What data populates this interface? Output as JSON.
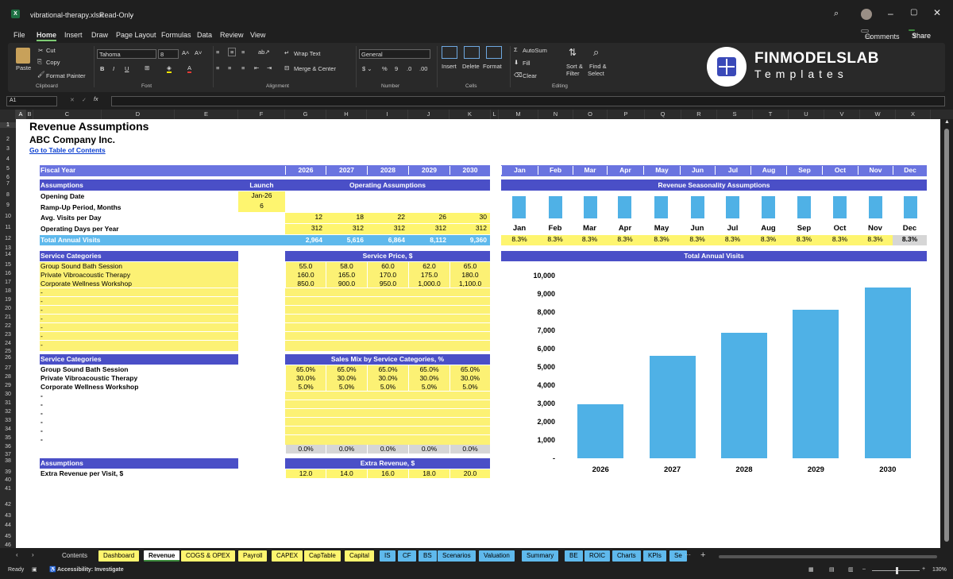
{
  "window": {
    "title": "vibrational-therapy.xlsx",
    "mode": "Read-Only"
  },
  "menu": [
    "File",
    "Home",
    "Insert",
    "Draw",
    "Page Layout",
    "Formulas",
    "Data",
    "Review",
    "View"
  ],
  "comments_label": "Comments",
  "share_label": "Share",
  "ribbon": {
    "paste": "Paste",
    "cut": "Cut",
    "copy": "Copy",
    "format_painter": "Format Painter",
    "clipboard": "Clipboard",
    "font_name": "Tahoma",
    "font_size": "8",
    "font": "Font",
    "wrap_text": "Wrap Text",
    "merge_center": "Merge & Center",
    "alignment": "Alignment",
    "number_format": "General",
    "number": "Number",
    "insert": "Insert",
    "delete": "Delete",
    "format": "Format",
    "cells": "Cells",
    "autosum": "AutoSum",
    "fill": "Fill",
    "clear": "Clear",
    "sort_filter_1": "Sort &",
    "sort_filter_2": "Filter",
    "find_select_1": "Find &",
    "find_select_2": "Select",
    "editing": "Editing",
    "brand_name": "FINMODELSLAB",
    "brand_sub": "Templates"
  },
  "formula_bar": {
    "cell_ref": "A1",
    "fx": "fx",
    "value": ""
  },
  "columns": [
    "A",
    "B",
    "C",
    "D",
    "E",
    "F",
    "G",
    "H",
    "I",
    "J",
    "K",
    "L",
    "M",
    "N",
    "O",
    "P",
    "Q",
    "R",
    "S",
    "T",
    "U",
    "V",
    "W",
    "X"
  ],
  "rows": [
    "1",
    "2",
    "3",
    "4",
    "5",
    "6",
    "7",
    "8",
    "9",
    "10",
    "11",
    "12",
    "13",
    "14",
    "15",
    "16",
    "17",
    "18",
    "19",
    "20",
    "21",
    "22",
    "23",
    "24",
    "25",
    "26",
    "27",
    "28",
    "29",
    "30",
    "31",
    "32",
    "33",
    "34",
    "35",
    "36",
    "37",
    "38",
    "39",
    "40",
    "41",
    "42",
    "43",
    "44",
    "45",
    "46"
  ],
  "sheet": {
    "title": "Revenue Assumptions",
    "company": "ABC Company Inc.",
    "toc_link": "Go to Table of Contents",
    "fiscal_year": "Fiscal Year",
    "years": [
      "2026",
      "2027",
      "2028",
      "2029",
      "2030"
    ],
    "months": [
      "Jan",
      "Feb",
      "Mar",
      "Apr",
      "May",
      "Jun",
      "Jul",
      "Aug",
      "Sep",
      "Oct",
      "Nov",
      "Dec"
    ],
    "assumptions": "Assumptions",
    "launch": "Launch",
    "operating_assumptions": "Operating Assumptions",
    "seasonality_header": "Revenue Seasonality Assumptions",
    "opening_date": "Opening Date",
    "opening_date_val": "Jan-26",
    "ramp_up": "Ramp-Up Period, Months",
    "ramp_up_val": "6",
    "avg_visits": "Avg. Visits per Day",
    "avg_visits_vals": [
      "12",
      "18",
      "22",
      "26",
      "30"
    ],
    "op_days": "Operating Days per Year",
    "op_days_vals": [
      "312",
      "312",
      "312",
      "312",
      "312"
    ],
    "total_visits": "Total Annual Visits",
    "total_visits_vals": [
      "2,964",
      "5,616",
      "6,864",
      "8,112",
      "9,360"
    ],
    "seasonality_pct": [
      "8.3%",
      "8.3%",
      "8.3%",
      "8.3%",
      "8.3%",
      "8.3%",
      "8.3%",
      "8.3%",
      "8.3%",
      "8.3%",
      "8.3%",
      "8.3%"
    ],
    "seasonality_values": [
      8.3,
      8.3,
      8.3,
      8.3,
      8.3,
      8.3,
      8.3,
      8.3,
      8.3,
      8.3,
      8.3,
      8.3
    ],
    "service_categories": "Service Categories",
    "service_price": "Service Price, $",
    "services": [
      "Group Sound Bath Session",
      "Private Vibroacoustic Therapy",
      "Corporate Wellness Workshop"
    ],
    "dash": "-",
    "prices": [
      [
        "55.0",
        "58.0",
        "60.0",
        "62.0",
        "65.0"
      ],
      [
        "160.0",
        "165.0",
        "170.0",
        "175.0",
        "180.0"
      ],
      [
        "850.0",
        "900.0",
        "950.0",
        "1,000.0",
        "1,100.0"
      ]
    ],
    "sales_mix_header": "Sales Mix by Service Categories, %",
    "mix": [
      [
        "65.0%",
        "65.0%",
        "65.0%",
        "65.0%",
        "65.0%"
      ],
      [
        "30.0%",
        "30.0%",
        "30.0%",
        "30.0%",
        "30.0%"
      ],
      [
        "5.0%",
        "5.0%",
        "5.0%",
        "5.0%",
        "5.0%"
      ]
    ],
    "mix_other": [
      "0.0%",
      "0.0%",
      "0.0%",
      "0.0%",
      "0.0%"
    ],
    "extra_revenue_header": "Extra Revenue, $",
    "extra_per_visit": "Extra Revenue per Visit, $",
    "extra_vals": [
      "12.0",
      "14.0",
      "16.0",
      "18.0",
      "20.0"
    ]
  },
  "chart_data": {
    "type": "bar",
    "title": "Total Annual Visits",
    "categories": [
      "2026",
      "2027",
      "2028",
      "2029",
      "2030"
    ],
    "values": [
      2964,
      5616,
      6864,
      8112,
      9360
    ],
    "yticks": [
      "-",
      "1,000",
      "2,000",
      "3,000",
      "4,000",
      "5,000",
      "6,000",
      "7,000",
      "8,000",
      "9,000",
      "10,000"
    ],
    "ylim": [
      0,
      10000
    ],
    "color": "#4fb1e6"
  },
  "tabs": [
    "Contents",
    "Dashboard",
    "Revenue",
    "COGS & OPEX",
    "Payroll",
    "CAPEX",
    "CapTable",
    "Capital",
    "IS",
    "CF",
    "BS",
    "Scenarios",
    "Valuation",
    "Summary",
    "BE",
    "ROIC",
    "Charts",
    "KPIs",
    "Se"
  ],
  "status": {
    "ready": "Ready",
    "accessibility": "Accessibility: Investigate",
    "zoom": "130%"
  }
}
